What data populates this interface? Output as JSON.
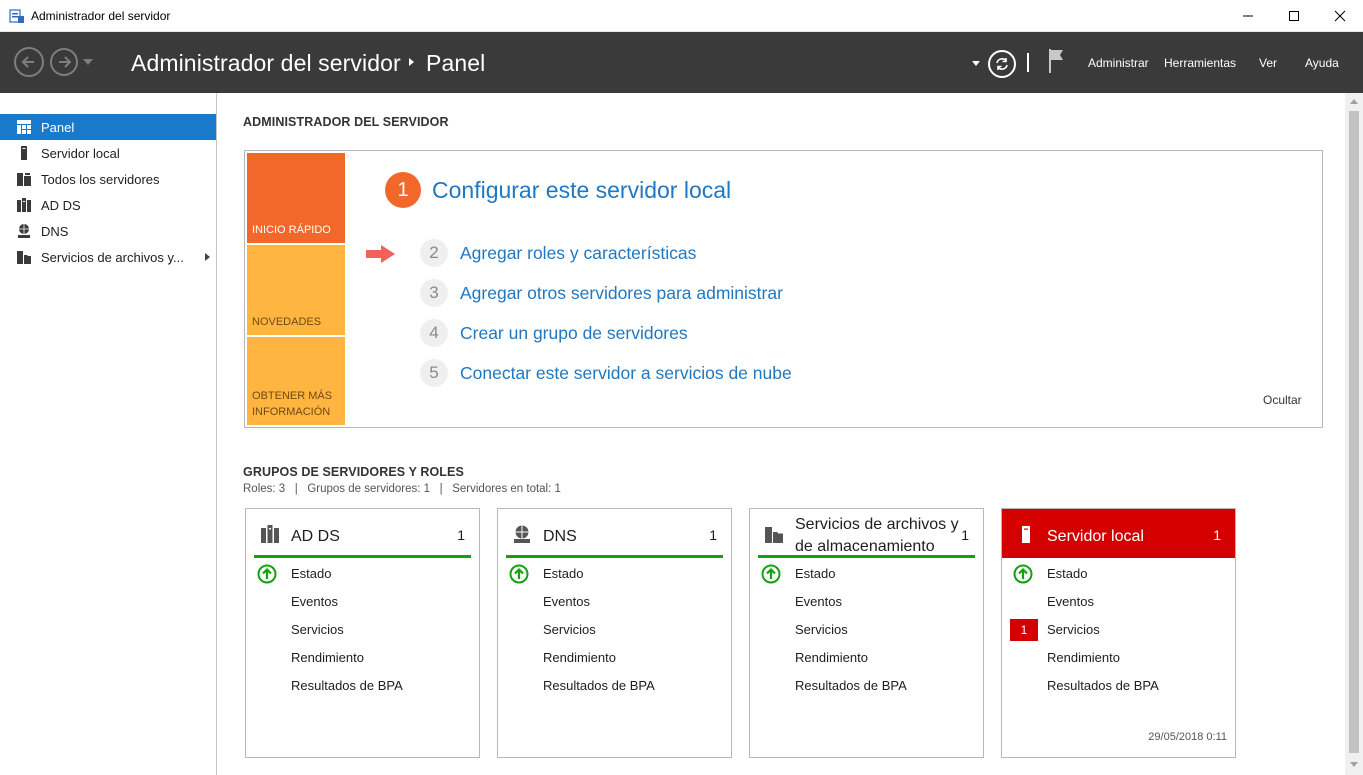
{
  "window": {
    "title": "Administrador del servidor"
  },
  "header": {
    "breadcrumb_root": "Administrador del servidor",
    "breadcrumb_current": "Panel",
    "menu": [
      "Administrar",
      "Herramientas",
      "Ver",
      "Ayuda"
    ]
  },
  "sidebar": {
    "items": [
      {
        "label": "Panel",
        "icon": "dashboard-icon",
        "selected": true
      },
      {
        "label": "Servidor local",
        "icon": "server-icon"
      },
      {
        "label": "Todos los servidores",
        "icon": "servers-icon"
      },
      {
        "label": "AD DS",
        "icon": "ad-ds-icon"
      },
      {
        "label": "DNS",
        "icon": "dns-icon"
      },
      {
        "label": "Servicios de archivos y...",
        "icon": "file-services-icon",
        "expandable": true
      }
    ]
  },
  "welcome": {
    "section_title": "ADMINISTRADOR DEL SERVIDOR",
    "tiles": [
      "INICIO RÁPIDO",
      "NOVEDADES",
      "OBTENER MÁS INFORMACIÓN"
    ],
    "step1": {
      "number": "1",
      "label": "Configurar este servidor local"
    },
    "steps": [
      {
        "number": "2",
        "label": "Agregar roles y características"
      },
      {
        "number": "3",
        "label": "Agregar otros servidores para administrar"
      },
      {
        "number": "4",
        "label": "Crear un grupo de servidores"
      },
      {
        "number": "5",
        "label": "Conectar este servidor a servicios de nube"
      }
    ],
    "hide_label": "Ocultar",
    "colors": {
      "orange": "#f2682a",
      "amber": "#ffb540",
      "link": "#1f78c1"
    }
  },
  "groups": {
    "section_title": "GRUPOS DE SERVIDORES Y ROLES",
    "stats": "Roles: 3   |   Grupos de servidores: 1   |   Servidores en total: 1",
    "row_labels": [
      "Estado",
      "Eventos",
      "Servicios",
      "Rendimiento",
      "Resultados de BPA"
    ],
    "cards": [
      {
        "title": "AD DS",
        "count": "1",
        "icon": "ad-ds-icon"
      },
      {
        "title": "DNS",
        "count": "1",
        "icon": "dns-icon"
      },
      {
        "title_line1": "Servicios de archivos y",
        "title_line2": "de almacenamiento",
        "count": "1",
        "icon": "file-services-icon"
      },
      {
        "title": "Servidor local",
        "count": "1",
        "icon": "server-icon",
        "alert_count": "1",
        "timestamp": "29/05/2018 0:11",
        "color": "#d40000"
      }
    ]
  }
}
